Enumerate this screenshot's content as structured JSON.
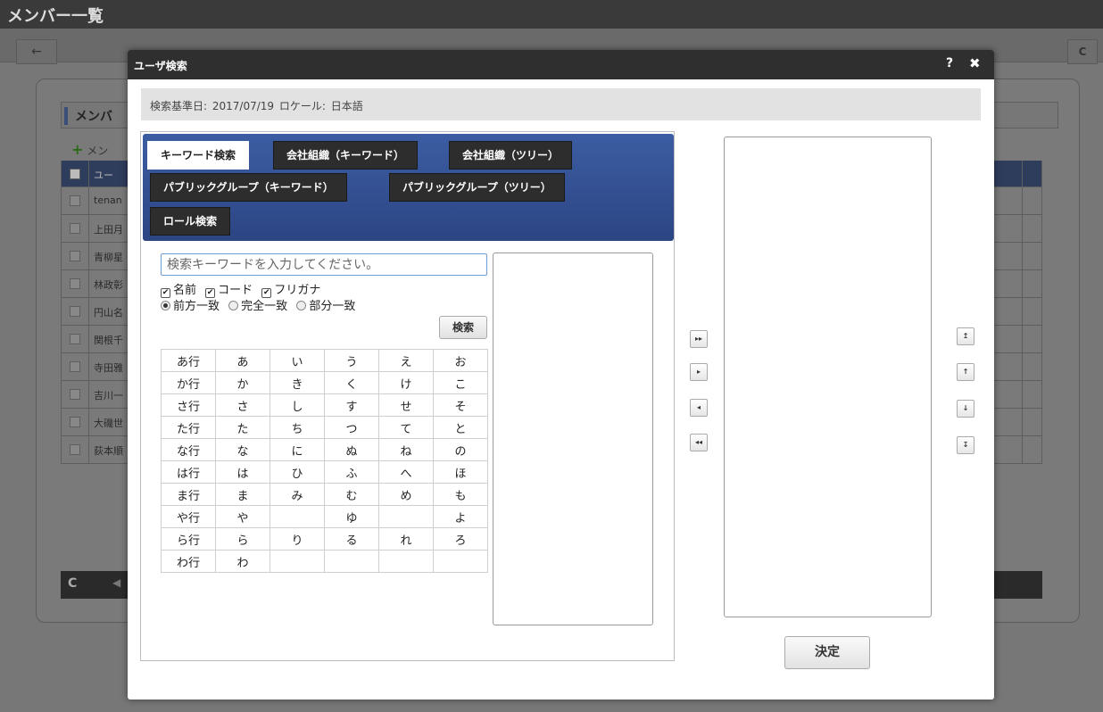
{
  "background": {
    "title": "メンバー一覧",
    "section_title": "メンバ",
    "add_label": "メン",
    "table_header": "ユー",
    "rows": [
      "tenan",
      "上田月",
      "青柳星",
      "林政彰",
      "円山名",
      "関根千",
      "寺田雅",
      "吉川一",
      "大磯世",
      "荻本順"
    ]
  },
  "modal": {
    "title": "ユーザ検索",
    "help": "?",
    "close": "✖",
    "info": "検索基準日: 2017/07/19 ロケール: 日本語",
    "tabs": [
      {
        "label": "キーワード検索"
      },
      {
        "label": "会社組織（キーワード）"
      },
      {
        "label": "会社組織（ツリー）"
      },
      {
        "label": "パブリックグループ（キーワード）"
      },
      {
        "label": "パブリックグループ（ツリー）"
      },
      {
        "label": "ロール検索"
      }
    ],
    "search": {
      "placeholder": "検索キーワードを入力してください。",
      "checks": [
        "名前",
        "コード",
        "フリガナ"
      ],
      "radios": [
        "前方一致",
        "完全一致",
        "部分一致"
      ],
      "button": "検索"
    },
    "kana_rows": [
      [
        "あ行",
        "あ",
        "い",
        "う",
        "え",
        "お"
      ],
      [
        "か行",
        "か",
        "き",
        "く",
        "け",
        "こ"
      ],
      [
        "さ行",
        "さ",
        "し",
        "す",
        "せ",
        "そ"
      ],
      [
        "た行",
        "た",
        "ち",
        "つ",
        "て",
        "と"
      ],
      [
        "な行",
        "な",
        "に",
        "ぬ",
        "ね",
        "の"
      ],
      [
        "は行",
        "は",
        "ひ",
        "ふ",
        "へ",
        "ほ"
      ],
      [
        "ま行",
        "ま",
        "み",
        "む",
        "め",
        "も"
      ],
      [
        "や行",
        "や",
        "",
        "ゆ",
        "",
        "よ"
      ],
      [
        "ら行",
        "ら",
        "り",
        "る",
        "れ",
        "ろ"
      ],
      [
        "わ行",
        "わ",
        "",
        "",
        "",
        ""
      ]
    ],
    "move_buttons": [
      "add-all",
      "add",
      "remove",
      "remove-all"
    ],
    "sort_buttons": [
      "move-top",
      "move-up",
      "move-down",
      "move-bottom"
    ],
    "confirm": "決定"
  }
}
